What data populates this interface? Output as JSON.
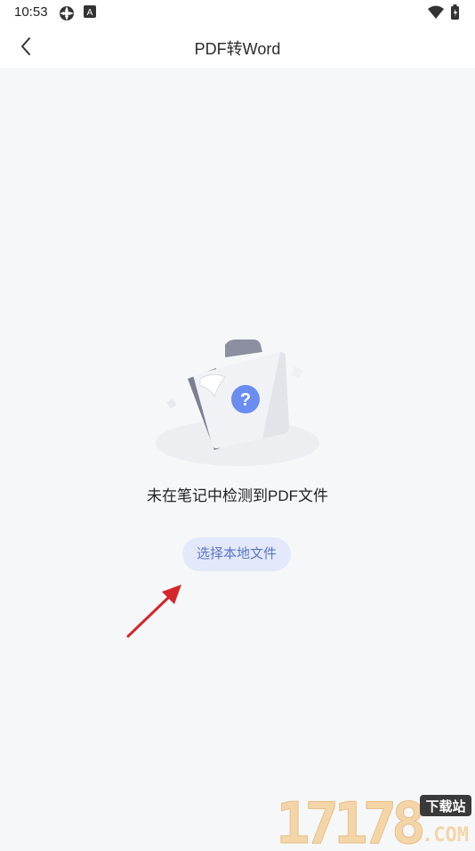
{
  "status_bar": {
    "time": "10:53",
    "icons_left": [
      "sync-icon",
      "a-badge-icon"
    ],
    "icons_right": [
      "wifi-icon",
      "battery-icon"
    ]
  },
  "header": {
    "title": "PDF转Word",
    "back_icon": "chevron-left-icon"
  },
  "empty_state": {
    "illustration_icon": "folder-question-icon",
    "message": "未在笔记中检测到PDF文件",
    "button_label": "选择本地文件"
  },
  "watermark": {
    "numbers": "17178",
    "badge": "下载站",
    "domain": ".COM"
  },
  "colors": {
    "background": "#f6f7f9",
    "button_bg": "#e3e9fb",
    "button_text": "#5a76c9",
    "question_badge": "#6b8cf0",
    "arrow": "#d6262b"
  }
}
